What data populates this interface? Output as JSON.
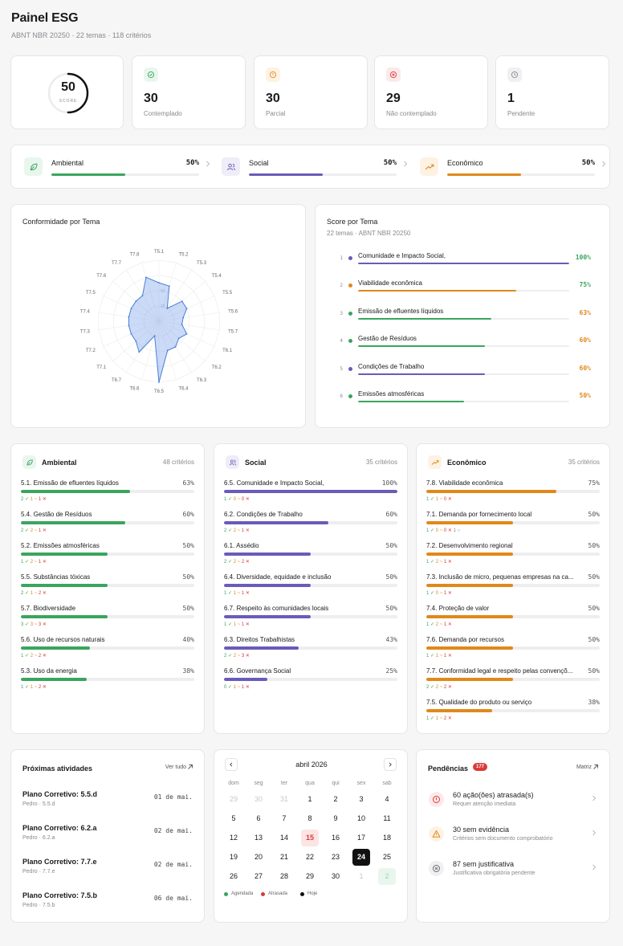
{
  "header": {
    "title": "Painel ESG",
    "subtitle": "ABNT NBR 20250 · 22 temas · 118 critérios"
  },
  "score": {
    "value": "50",
    "label": "SCORE",
    "fraction": 0.5
  },
  "stats": [
    {
      "value": "30",
      "label": "Contemplado",
      "icon": "check-circle-icon",
      "color": "#3aa55d",
      "bg": "#e9f6ee"
    },
    {
      "value": "30",
      "label": "Parcial",
      "icon": "alert-circle-icon",
      "color": "#e0891a",
      "bg": "#fdf2e3"
    },
    {
      "value": "29",
      "label": "Não contemplado",
      "icon": "x-circle-icon",
      "color": "#d93b3b",
      "bg": "#fce9e9"
    },
    {
      "value": "1",
      "label": "Pendente",
      "icon": "clock-icon",
      "color": "#8a8a8f",
      "bg": "#f0f0f2"
    }
  ],
  "pillars": [
    {
      "name": "Ambiental",
      "pct": "50%",
      "value": 0.5,
      "color": "#3aa55d",
      "bg": "#e9f6ee",
      "icon": "leaf-icon"
    },
    {
      "name": "Social",
      "pct": "50%",
      "value": 0.5,
      "color": "#6b5bb8",
      "bg": "#efedf8",
      "icon": "users-icon"
    },
    {
      "name": "Econômico",
      "pct": "50%",
      "value": 0.5,
      "color": "#e0891a",
      "bg": "#fdf2e3",
      "icon": "trending-up-icon"
    }
  ],
  "radar": {
    "title": "Conformidade por Tema",
    "labels": [
      "T5.1",
      "T5.2",
      "T5.3",
      "T5.4",
      "T5.5",
      "T5.6",
      "T5.7",
      "T6.1",
      "T6.2",
      "T6.3",
      "T6.4",
      "T6.5",
      "T6.6",
      "T6.7",
      "T7.1",
      "T7.2",
      "T7.3",
      "T7.4",
      "T7.5",
      "T7.6",
      "T7.7",
      "T7.8"
    ],
    "values": [
      63,
      60,
      25,
      50,
      50,
      40,
      38,
      50,
      43,
      50,
      50,
      100,
      25,
      60,
      50,
      50,
      50,
      50,
      50,
      50,
      50,
      75
    ],
    "rings": [
      "25",
      "50"
    ]
  },
  "score_tema": {
    "title": "Score por Tema",
    "subtitle": "22 temas · ABNT NBR 20250",
    "items": [
      {
        "rank": "1",
        "name": "Comunidade e Impacto Social,",
        "pct": "100%",
        "value": 1.0,
        "color": "#6b5bb8",
        "pct_color": "#3aa55d"
      },
      {
        "rank": "2",
        "name": "Viabilidade econômica",
        "pct": "75%",
        "value": 0.75,
        "color": "#e0891a",
        "pct_color": "#3aa55d"
      },
      {
        "rank": "3",
        "name": "Emissão de efluentes líquidos",
        "pct": "63%",
        "value": 0.63,
        "color": "#3aa55d",
        "pct_color": "#e0891a"
      },
      {
        "rank": "4",
        "name": "Gestão de Resíduos",
        "pct": "60%",
        "value": 0.6,
        "color": "#3aa55d",
        "pct_color": "#e0891a"
      },
      {
        "rank": "5",
        "name": "Condições de Trabalho",
        "pct": "60%",
        "value": 0.6,
        "color": "#6b5bb8",
        "pct_color": "#e0891a"
      },
      {
        "rank": "6",
        "name": "Emissões atmosféricas",
        "pct": "50%",
        "value": 0.5,
        "color": "#3aa55d",
        "pct_color": "#e0891a"
      }
    ]
  },
  "criteria": [
    {
      "title": "Ambiental",
      "count": "48 critérios",
      "color": "#3aa55d",
      "bg": "#e9f6ee",
      "icon": "leaf-icon",
      "rows": [
        {
          "name": "5.1. Emissão de efluentes líquidos",
          "pct": "63%",
          "value": 0.63,
          "c": "2 ✓",
          "p": "1 ~",
          "n": "1 ✕",
          "x": ""
        },
        {
          "name": "5.4. Gestão de Resíduos",
          "pct": "60%",
          "value": 0.6,
          "c": "2 ✓",
          "p": "2 ~",
          "n": "1 ✕",
          "x": ""
        },
        {
          "name": "5.2. Emissões atmosféricas",
          "pct": "50%",
          "value": 0.5,
          "c": "1 ✓",
          "p": "2 ~",
          "n": "1 ✕",
          "x": ""
        },
        {
          "name": "5.5. Substâncias tóxicas",
          "pct": "50%",
          "value": 0.5,
          "c": "2 ✓",
          "p": "1 ~",
          "n": "2 ✕",
          "x": ""
        },
        {
          "name": "5.7. Biodiversidade",
          "pct": "50%",
          "value": 0.5,
          "c": "3 ✓",
          "p": "3 ~",
          "n": "3 ✕",
          "x": ""
        },
        {
          "name": "5.6. Uso de recursos naturais",
          "pct": "40%",
          "value": 0.4,
          "c": "1 ✓",
          "p": "2 ~",
          "n": "2 ✕",
          "x": ""
        },
        {
          "name": "5.3. Uso da energia",
          "pct": "38%",
          "value": 0.38,
          "c": "1 ✓",
          "p": "1 ~",
          "n": "2 ✕",
          "x": ""
        }
      ]
    },
    {
      "title": "Social",
      "count": "35 critérios",
      "color": "#6b5bb8",
      "bg": "#efedf8",
      "icon": "users-icon",
      "rows": [
        {
          "name": "6.5. Comunidade e Impacto Social,",
          "pct": "100%",
          "value": 1.0,
          "c": "1 ✓",
          "p": "0 ~",
          "n": "0 ✕",
          "x": ""
        },
        {
          "name": "6.2. Condições de Trabalho",
          "pct": "60%",
          "value": 0.6,
          "c": "2 ✓",
          "p": "2 ~",
          "n": "1 ✕",
          "x": ""
        },
        {
          "name": "6.1. Assédio",
          "pct": "50%",
          "value": 0.5,
          "c": "2 ✓",
          "p": "2 ~",
          "n": "2 ✕",
          "x": ""
        },
        {
          "name": "6.4. Diversidade, equidade e inclusão",
          "pct": "50%",
          "value": 0.5,
          "c": "1 ✓",
          "p": "1 ~",
          "n": "1 ✕",
          "x": ""
        },
        {
          "name": "6.7. Respeito às comunidades locais",
          "pct": "50%",
          "value": 0.5,
          "c": "1 ✓",
          "p": "1 ~",
          "n": "1 ✕",
          "x": ""
        },
        {
          "name": "6.3. Direitos Trabalhistas",
          "pct": "43%",
          "value": 0.43,
          "c": "2 ✓",
          "p": "2 ~",
          "n": "3 ✕",
          "x": ""
        },
        {
          "name": "6.6. Governança Social",
          "pct": "25%",
          "value": 0.25,
          "c": "0 ✓",
          "p": "1 ~",
          "n": "1 ✕",
          "x": ""
        }
      ]
    },
    {
      "title": "Econômico",
      "count": "35 critérios",
      "color": "#e0891a",
      "bg": "#fdf2e3",
      "icon": "trending-up-icon",
      "rows": [
        {
          "name": "7.8. Viabilidade econômica",
          "pct": "75%",
          "value": 0.75,
          "c": "1 ✓",
          "p": "1 ~",
          "n": "0 ✕",
          "x": ""
        },
        {
          "name": "7.1. Demanda por fornecimento local",
          "pct": "50%",
          "value": 0.5,
          "c": "1 ✓",
          "p": "0 ~",
          "n": "0 ✕",
          "x": "1 ○"
        },
        {
          "name": "7.2. Desenvolvimento regional",
          "pct": "50%",
          "value": 0.5,
          "c": "1 ✓",
          "p": "2 ~",
          "n": "1 ✕",
          "x": ""
        },
        {
          "name": "7.3. Inclusão de micro, pequenas empresas na ca...",
          "pct": "50%",
          "value": 0.5,
          "c": "1 ✓",
          "p": "0 ~",
          "n": "1 ✕",
          "x": ""
        },
        {
          "name": "7.4. Proteção de valor",
          "pct": "50%",
          "value": 0.5,
          "c": "1 ✓",
          "p": "2 ~",
          "n": "1 ✕",
          "x": ""
        },
        {
          "name": "7.6. Demanda por recursos",
          "pct": "50%",
          "value": 0.5,
          "c": "1 ✓",
          "p": "1 ~",
          "n": "1 ✕",
          "x": ""
        },
        {
          "name": "7.7. Conformidad legal e respeito pelas convençõ...",
          "pct": "50%",
          "value": 0.5,
          "c": "2 ✓",
          "p": "2 ~",
          "n": "2 ✕",
          "x": ""
        },
        {
          "name": "7.5. Qualidade do produto ou serviço",
          "pct": "38%",
          "value": 0.38,
          "c": "1 ✓",
          "p": "1 ~",
          "n": "2 ✕",
          "x": ""
        }
      ]
    }
  ],
  "activities": {
    "title": "Próximas atividades",
    "see_all": "Ver tudo",
    "items": [
      {
        "title": "Plano Corretivo: 5.5.d",
        "sub": "Pedro · 5.5.d",
        "date": "01 de mai."
      },
      {
        "title": "Plano Corretivo: 6.2.a",
        "sub": "Pedro · 6.2.a",
        "date": "02 de mai."
      },
      {
        "title": "Plano Corretivo: 7.7.e",
        "sub": "Pedro · 7.7.e",
        "date": "02 de mai."
      },
      {
        "title": "Plano Corretivo: 7.5.b",
        "sub": "Pedro · 7.5.b",
        "date": "06 de mai."
      }
    ]
  },
  "calendar": {
    "month": "abril 2026",
    "weekdays": [
      "dom",
      "seg",
      "ter",
      "qua",
      "qui",
      "sex",
      "sab"
    ],
    "weeks": [
      [
        {
          "d": "29",
          "m": "out"
        },
        {
          "d": "30",
          "m": "out"
        },
        {
          "d": "31",
          "m": "out"
        },
        {
          "d": "1"
        },
        {
          "d": "2"
        },
        {
          "d": "3"
        },
        {
          "d": "4"
        }
      ],
      [
        {
          "d": "5"
        },
        {
          "d": "6"
        },
        {
          "d": "7"
        },
        {
          "d": "8"
        },
        {
          "d": "9"
        },
        {
          "d": "10"
        },
        {
          "d": "11"
        }
      ],
      [
        {
          "d": "12"
        },
        {
          "d": "13"
        },
        {
          "d": "14"
        },
        {
          "d": "15",
          "m": "late"
        },
        {
          "d": "16"
        },
        {
          "d": "17"
        },
        {
          "d": "18"
        }
      ],
      [
        {
          "d": "19"
        },
        {
          "d": "20"
        },
        {
          "d": "21"
        },
        {
          "d": "22"
        },
        {
          "d": "23"
        },
        {
          "d": "24",
          "m": "today"
        },
        {
          "d": "25"
        }
      ],
      [
        {
          "d": "26"
        },
        {
          "d": "27"
        },
        {
          "d": "28"
        },
        {
          "d": "29"
        },
        {
          "d": "30"
        },
        {
          "d": "1",
          "m": "out"
        },
        {
          "d": "2",
          "m": "sched"
        }
      ]
    ],
    "legend": {
      "scheduled": "Agendada",
      "late": "Atrasada",
      "today": "Hoje"
    }
  },
  "pendencias": {
    "title": "Pendências",
    "badge": "177",
    "link": "Matriz",
    "items": [
      {
        "title": "60 ação(ões) atrasada(s)",
        "sub": "Requer atenção imediata",
        "icon": "alert-circle-icon",
        "color": "#d93b3b",
        "bg": "#fce9e9"
      },
      {
        "title": "30 sem evidência",
        "sub": "Critérios sem documento comprobatório",
        "icon": "warning-triangle-icon",
        "color": "#e0891a",
        "bg": "#fdf2e3"
      },
      {
        "title": "87 sem justificativa",
        "sub": "Justificativa obrigatória pendente",
        "icon": "x-circle-icon",
        "color": "#6a6a70",
        "bg": "#f0f0f2"
      }
    ]
  }
}
